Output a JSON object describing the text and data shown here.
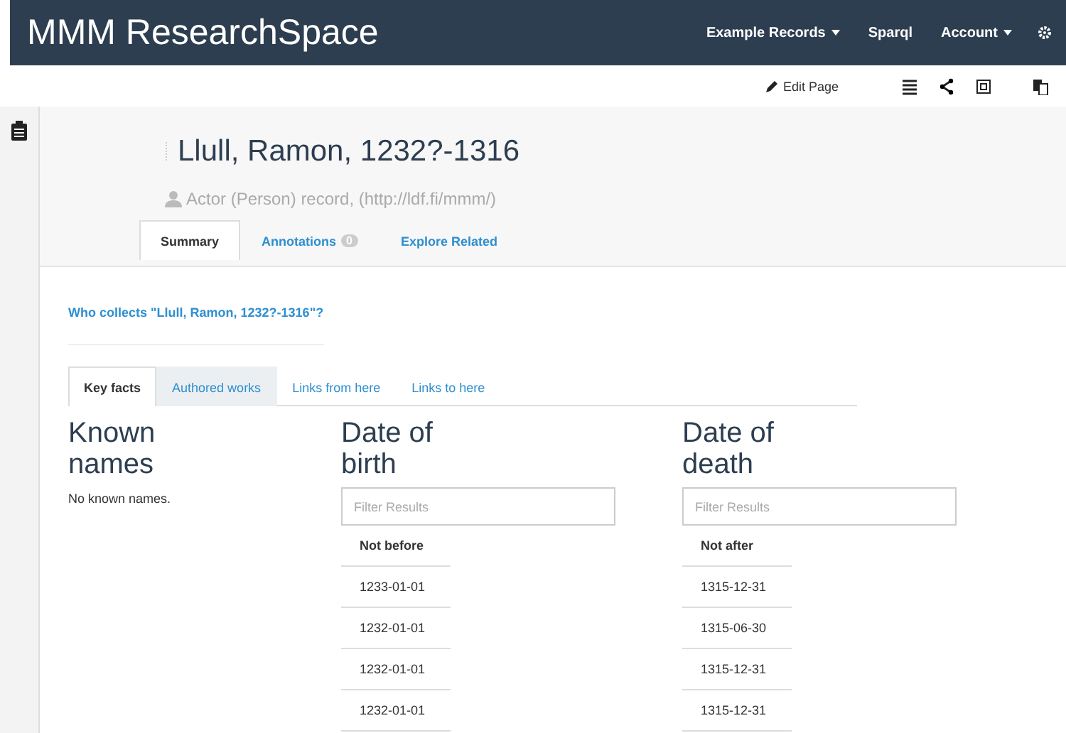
{
  "navbar": {
    "brand": "MMM ResearchSpace",
    "items": [
      {
        "label": "Example Records",
        "dropdown": true
      },
      {
        "label": "Sparql",
        "dropdown": false
      },
      {
        "label": "Account",
        "dropdown": true
      }
    ]
  },
  "toolbar": {
    "edit_label": "Edit Page"
  },
  "record": {
    "title": "Llull, Ramon, 1232?-1316",
    "subtitle": "Actor (Person) record, (http://ldf.fi/mmm/)"
  },
  "record_tabs": [
    {
      "label": "Summary",
      "selected": true
    },
    {
      "label": "Annotations",
      "badge": "0",
      "selected": false
    },
    {
      "label": "Explore Related",
      "selected": false
    }
  ],
  "question_link": "Who collects \"Llull, Ramon, 1232?-1316\"?",
  "content_tabs": [
    {
      "label": "Key facts",
      "selected": true,
      "hovered": false
    },
    {
      "label": "Authored works",
      "selected": false,
      "hovered": true
    },
    {
      "label": "Links from here",
      "selected": false,
      "hovered": false
    },
    {
      "label": "Links to here",
      "selected": false,
      "hovered": false
    }
  ],
  "sections": [
    {
      "title_lines": [
        "Known",
        "names"
      ],
      "kind": "text",
      "text": "No known names."
    },
    {
      "title_lines": [
        "Date of",
        "birth"
      ],
      "kind": "table",
      "placeholder": "Filter Results",
      "column": "Not before",
      "rows": [
        "1233-01-01",
        "1232-01-01",
        "1232-01-01",
        "1232-01-01"
      ]
    },
    {
      "title_lines": [
        "Date of",
        "death"
      ],
      "kind": "table",
      "placeholder": "Filter Results",
      "column": "Not after",
      "rows": [
        "1315-12-31",
        "1315-06-30",
        "1315-12-31",
        "1315-12-31"
      ]
    }
  ]
}
